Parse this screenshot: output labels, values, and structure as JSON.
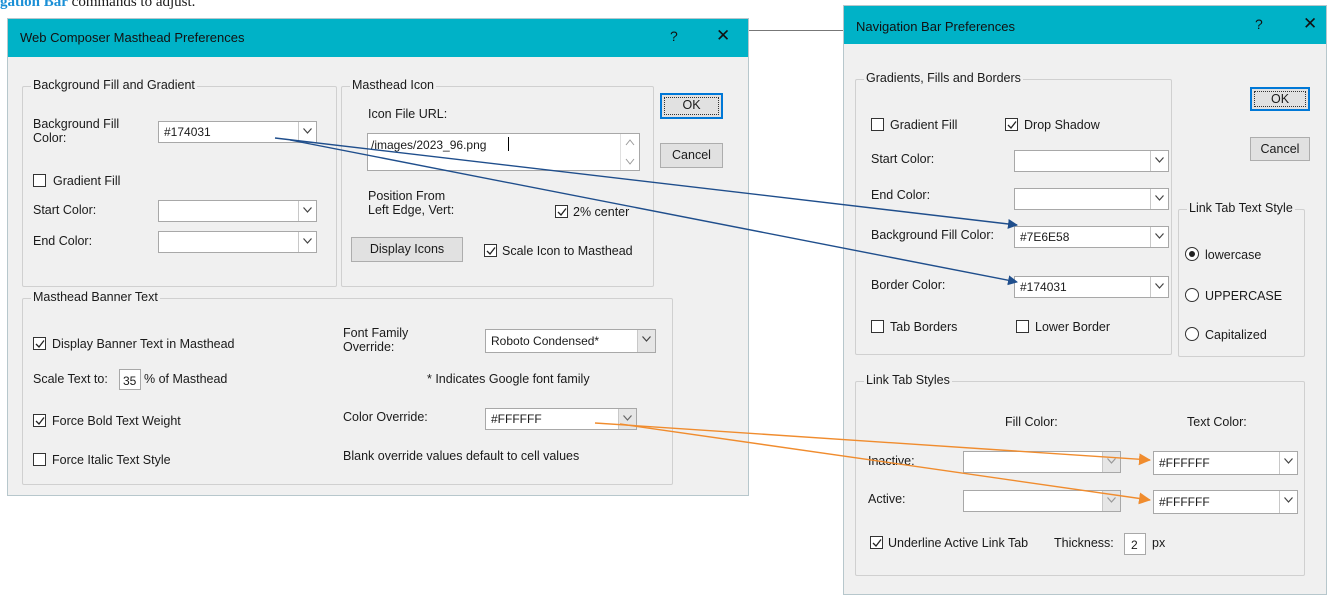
{
  "doc_header": {
    "link_text": "gation Bar",
    "rest_text": " commands to adjust."
  },
  "masthead_dialog": {
    "title": "Web Composer Masthead Preferences",
    "help": "?",
    "close": "✕",
    "ok": "OK",
    "cancel": "Cancel",
    "bg_group": {
      "legend": "Background Fill and Gradient",
      "fill_color_label": "Background Fill\nColor:",
      "fill_color_value": "#174031",
      "gradient_fill_label": "Gradient Fill",
      "gradient_fill_checked": false,
      "start_color_label": "Start Color:",
      "end_color_label": "End Color:"
    },
    "icon_group": {
      "legend": "Masthead Icon",
      "url_label": "Icon File URL:",
      "url_value": "/images/2023_96.png",
      "position_label": "Position From\nLeft Edge, Vert:",
      "center_label": "2% center",
      "center_checked": true,
      "display_icons": "Display Icons",
      "scale_label": "Scale Icon to Masthead",
      "scale_checked": true
    },
    "banner_group": {
      "legend": "Masthead Banner Text",
      "display_banner_label": "Display Banner Text in Masthead",
      "display_banner_checked": true,
      "scale_text_label": "Scale Text to:",
      "scale_text_value": "35",
      "scale_text_suffix": "% of Masthead",
      "force_bold_label": "Force Bold Text Weight",
      "force_bold_checked": true,
      "force_italic_label": "Force Italic Text Style",
      "force_italic_checked": false,
      "font_family_label": "Font Family\nOverride:",
      "font_family_value": "Roboto Condensed*",
      "google_note": "* Indicates Google font family",
      "color_override_label": "Color Override:",
      "color_override_value": "#FFFFFF",
      "blank_note": "Blank override values default to cell values"
    }
  },
  "navbar_dialog": {
    "title": "Navigation Bar Preferences",
    "help": "?",
    "close": "✕",
    "ok": "OK",
    "cancel": "Cancel",
    "gfb_group": {
      "legend": "Gradients, Fills and Borders",
      "gradient_fill_label": "Gradient Fill",
      "gradient_fill_checked": false,
      "drop_shadow_label": "Drop Shadow",
      "drop_shadow_checked": true,
      "start_color_label": "Start Color:",
      "end_color_label": "End Color:",
      "bg_fill_label": "Background Fill Color:",
      "bg_fill_value": "#7E6E58",
      "border_color_label": "Border Color:",
      "border_color_value": "#174031",
      "tab_borders_label": "Tab Borders",
      "tab_borders_checked": false,
      "lower_border_label": "Lower Border",
      "lower_border_checked": false
    },
    "text_style_group": {
      "legend": "Link Tab Text Style",
      "options": [
        "lowercase",
        "UPPERCASE",
        "Capitalized"
      ],
      "selected": "lowercase"
    },
    "link_tab_group": {
      "legend": "Link Tab Styles",
      "fill_color_header": "Fill Color:",
      "text_color_header": "Text Color:",
      "inactive_label": "Inactive:",
      "inactive_text_value": "#FFFFFF",
      "active_label": "Active:",
      "active_text_value": "#FFFFFF",
      "underline_label": "Underline Active Link Tab",
      "underline_checked": true,
      "thickness_label": "Thickness:",
      "thickness_value": "2",
      "thickness_unit": "px"
    }
  },
  "colors": {
    "titlebar": "#00b2c7",
    "dialog_bg": "#f0f0f0",
    "blue_arrow": "#1f4e8c",
    "orange_arrow": "#f08c2e",
    "link_blue": "#1a8fd6"
  }
}
